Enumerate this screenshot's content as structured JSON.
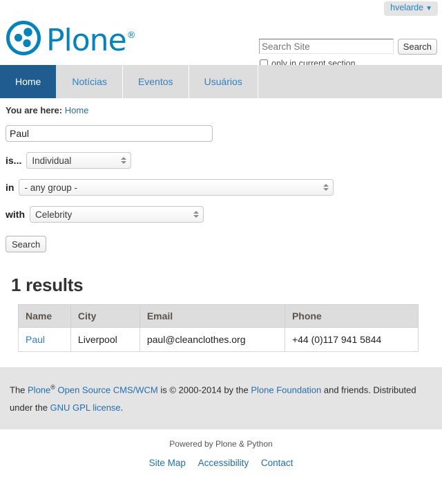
{
  "userbar": {
    "user_label": "hvelarde",
    "caret": "▼"
  },
  "header": {
    "logo_text": "Plone",
    "logo_registered": "®",
    "logo_icon": "plone-logo-icon"
  },
  "search": {
    "placeholder": "Search Site",
    "value": "",
    "button_label": "Search",
    "checkbox_label": "only in current section",
    "checkbox_checked": false
  },
  "nav": {
    "tabs": [
      {
        "label": "Home",
        "active": true
      },
      {
        "label": "Notícias",
        "active": false
      },
      {
        "label": "Eventos",
        "active": false
      },
      {
        "label": "Usuários",
        "active": false
      }
    ]
  },
  "breadcrumb": {
    "label": "You are here:",
    "items": [
      "Home"
    ]
  },
  "form": {
    "name_value": "Paul",
    "name_placeholder": "",
    "fields": [
      {
        "label": "is...",
        "value": "Individual"
      },
      {
        "label": "in",
        "value": "- any group -"
      },
      {
        "label": "with",
        "value": "Celebrity"
      }
    ],
    "submit_label": "Search"
  },
  "results": {
    "title": "1 results",
    "columns": [
      "Name",
      "City",
      "Email",
      "Phone"
    ],
    "rows": [
      {
        "name": "Paul",
        "city": "Liverpool",
        "email": "paul@cleanclothes.org",
        "phone": "+44 (0)117 941 5844"
      }
    ]
  },
  "footer": {
    "t1": "The ",
    "link_plone": "Plone",
    "reg": "®",
    "link_oscms": " Open Source CMS/WCM",
    "t2": " is © 2000-2014 by the ",
    "link_foundation": "Plone Foundation",
    "t3": " and friends. Distributed under the ",
    "link_license": "GNU GPL license",
    "t4": ".",
    "colophon": "Powered by Plone & Python",
    "site_actions": [
      "Site Map",
      "Accessibility",
      "Contact"
    ]
  },
  "colors": {
    "brand": "#0083be",
    "link": "#2f82c4",
    "active_tab": "#205c90",
    "nav_bg": "#dddddd",
    "footer_bg": "#e4e4e4"
  }
}
